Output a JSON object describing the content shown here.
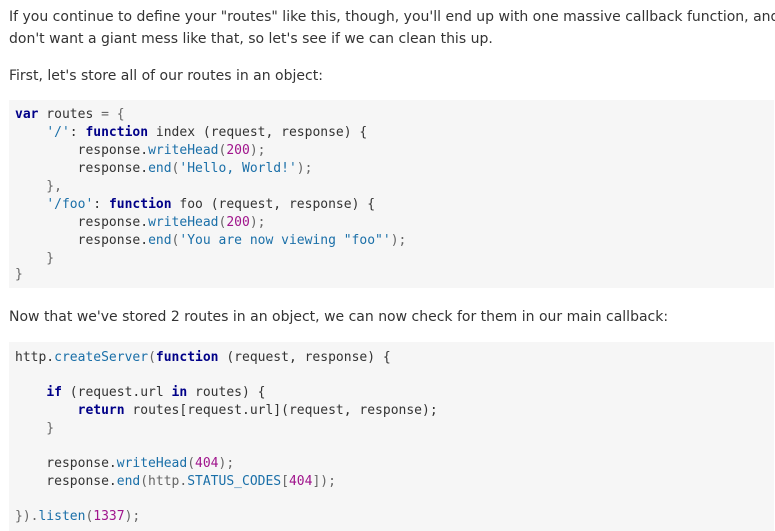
{
  "paragraphs": {
    "p1_line1": "If you continue to define your \"routes\" like this, though, you'll end up with one massive callback function, and we",
    "p1_line2": "don't want a giant mess like that, so let's see if we can clean this up.",
    "p2": "First, let's store all of our routes in an object:",
    "p3": "Now that we've stored 2 routes in an object, we can now check for them in our main callback:"
  },
  "code1": {
    "l1_a": "var",
    "l1_b": " routes ",
    "l1_c": "= {",
    "l2_a": "    ",
    "l2_str": "'/'",
    "l2_b": ": ",
    "l2_kw": "function",
    "l2_c": " index (request, response) {",
    "l3_a": "        response.",
    "l3_fn": "writeHead",
    "l3_b": "(",
    "l3_num": "200",
    "l3_c": ");",
    "l4_a": "        response.",
    "l4_fn": "end",
    "l4_b": "(",
    "l4_str": "'Hello, World!'",
    "l4_c": ");",
    "l5": "    },",
    "l6_a": "    ",
    "l6_str": "'/foo'",
    "l6_b": ": ",
    "l6_kw": "function",
    "l6_c": " foo (request, response) {",
    "l7_a": "        response.",
    "l7_fn": "writeHead",
    "l7_b": "(",
    "l7_num": "200",
    "l7_c": ");",
    "l8_a": "        response.",
    "l8_fn": "end",
    "l8_b": "(",
    "l8_str": "'You are now viewing \"foo\"'",
    "l8_c": ");",
    "l9": "    }",
    "l10": "}"
  },
  "code2": {
    "l1_a": "http.",
    "l1_fn": "createServer",
    "l1_b": "(",
    "l1_kw": "function",
    "l1_c": " (request, response) {",
    "l3_a": "    ",
    "l3_kw1": "if",
    "l3_b": " (request.url ",
    "l3_kw2": "in",
    "l3_c": " routes) {",
    "l4_a": "        ",
    "l4_kw": "return",
    "l4_b": " routes[request.url](request, response);",
    "l5": "    }",
    "l7_a": "    response.",
    "l7_fn": "writeHead",
    "l7_b": "(",
    "l7_num": "404",
    "l7_c": ");",
    "l8_a": "    response.",
    "l8_fn": "end",
    "l8_b": "(http.",
    "l8_prop": "STATUS_CODES",
    "l8_c": "[",
    "l8_num": "404",
    "l8_d": "]);",
    "l10_a": "}).",
    "l10_fn": "listen",
    "l10_b": "(",
    "l10_num": "1337",
    "l10_c": ");"
  }
}
